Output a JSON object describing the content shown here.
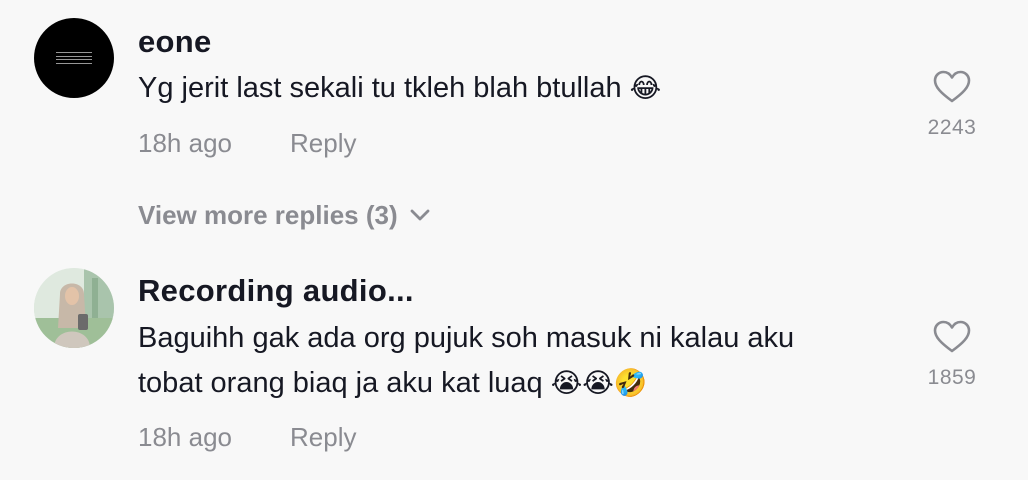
{
  "comments": [
    {
      "username": "eone",
      "text_lines": [
        "Yg jerit last sekali tu tkleh blah btullah"
      ],
      "emojis": "😂",
      "time": "18h ago",
      "reply_label": "Reply",
      "likes": "2243",
      "avatar_icon": "black-avatar"
    },
    {
      "username": "Recording audio...",
      "text_lines": [
        "Baguihh gak ada org pujuk soh masuk ni kalau aku",
        "tobat orang biaq ja aku kat luaq"
      ],
      "emojis": "😭😭🤣",
      "time": "18h ago",
      "reply_label": "Reply",
      "likes": "1859",
      "avatar_icon": "photo-avatar"
    }
  ],
  "view_more_label": "View more replies (3)",
  "colors": {
    "background": "#f8f8f8",
    "text_primary": "#161823",
    "text_secondary": "#8a8b91"
  }
}
